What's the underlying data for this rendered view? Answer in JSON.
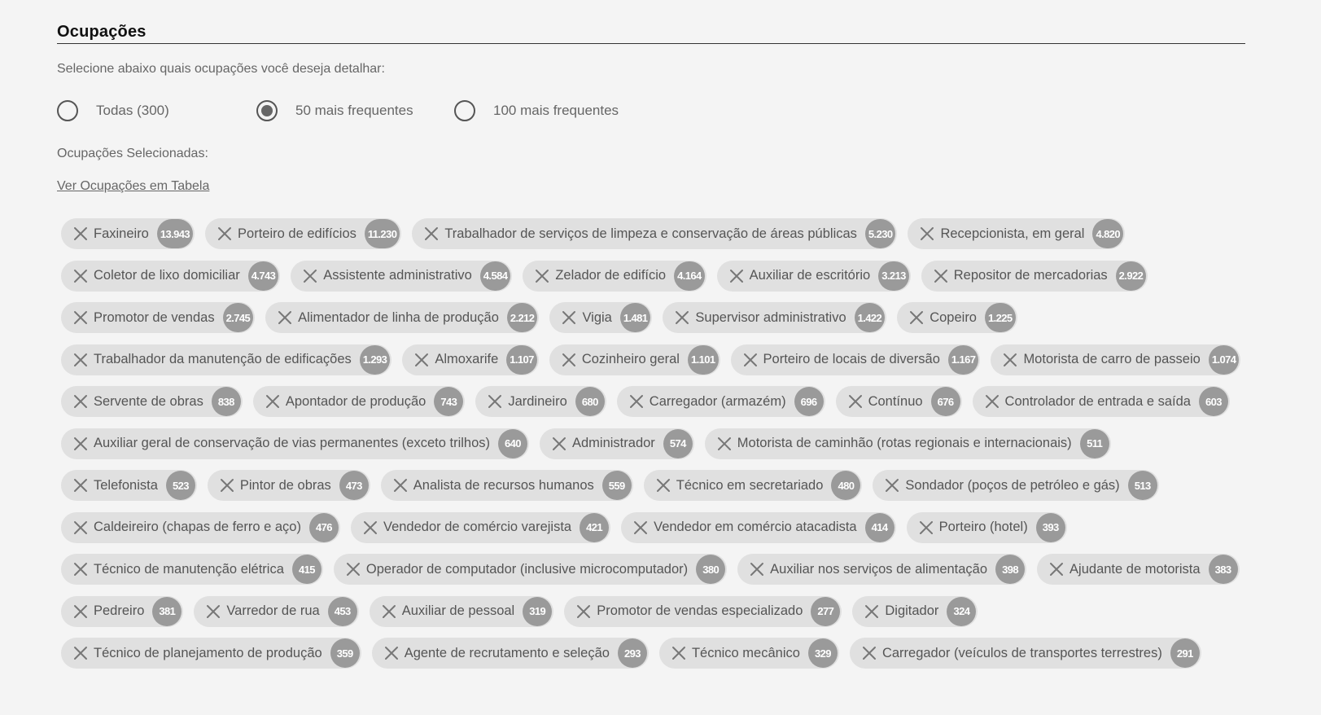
{
  "section": {
    "title": "Ocupações",
    "prompt": "Selecione abaixo quais ocupações você deseja detalhar:",
    "selected_label": "Ocupações Selecionadas:",
    "table_link": "Ver Ocupações em Tabela"
  },
  "radio_options": [
    {
      "label": "Todas (300)",
      "checked": false
    },
    {
      "label": "50 mais frequentes",
      "checked": true
    },
    {
      "label": "100 mais frequentes",
      "checked": false
    }
  ],
  "occupations": [
    {
      "label": "Faxineiro",
      "count": "13.943"
    },
    {
      "label": "Porteiro de edifícios",
      "count": "11.230"
    },
    {
      "label": "Trabalhador de serviços de limpeza e conservação de áreas públicas",
      "count": "5.230"
    },
    {
      "label": "Recepcionista, em geral",
      "count": "4.820"
    },
    {
      "label": "Coletor de lixo domiciliar",
      "count": "4.743"
    },
    {
      "label": "Assistente administrativo",
      "count": "4.584"
    },
    {
      "label": "Zelador de edifício",
      "count": "4.164"
    },
    {
      "label": "Auxiliar de escritório",
      "count": "3.213"
    },
    {
      "label": "Repositor de mercadorias",
      "count": "2.922"
    },
    {
      "label": "Promotor de vendas",
      "count": "2.745"
    },
    {
      "label": "Alimentador de linha de produção",
      "count": "2.212"
    },
    {
      "label": "Vigia",
      "count": "1.481"
    },
    {
      "label": "Supervisor administrativo",
      "count": "1.422"
    },
    {
      "label": "Copeiro",
      "count": "1.225"
    },
    {
      "label": "Trabalhador da manutenção de edificações",
      "count": "1.293"
    },
    {
      "label": "Almoxarife",
      "count": "1.107"
    },
    {
      "label": "Cozinheiro geral",
      "count": "1.101"
    },
    {
      "label": "Porteiro de locais de diversão",
      "count": "1.167"
    },
    {
      "label": "Motorista de carro de passeio",
      "count": "1.074"
    },
    {
      "label": "Servente de obras",
      "count": "838"
    },
    {
      "label": "Apontador de produção",
      "count": "743"
    },
    {
      "label": "Jardineiro",
      "count": "680"
    },
    {
      "label": "Carregador (armazém)",
      "count": "696"
    },
    {
      "label": "Contínuo",
      "count": "676"
    },
    {
      "label": "Controlador de entrada e saída",
      "count": "603"
    },
    {
      "label": "Auxiliar geral de conservação de vias permanentes (exceto trilhos)",
      "count": "640"
    },
    {
      "label": "Administrador",
      "count": "574"
    },
    {
      "label": "Motorista de caminhão (rotas regionais e internacionais)",
      "count": "511"
    },
    {
      "label": "Telefonista",
      "count": "523"
    },
    {
      "label": "Pintor de obras",
      "count": "473"
    },
    {
      "label": "Analista de recursos humanos",
      "count": "559"
    },
    {
      "label": "Técnico em secretariado",
      "count": "480"
    },
    {
      "label": "Sondador (poços de petróleo e gás)",
      "count": "513"
    },
    {
      "label": "Caldeireiro (chapas de ferro e aço)",
      "count": "476"
    },
    {
      "label": "Vendedor de comércio varejista",
      "count": "421"
    },
    {
      "label": "Vendedor em comércio atacadista",
      "count": "414"
    },
    {
      "label": "Porteiro (hotel)",
      "count": "393"
    },
    {
      "label": "Técnico de manutenção elétrica",
      "count": "415"
    },
    {
      "label": "Operador de computador (inclusive microcomputador)",
      "count": "380"
    },
    {
      "label": "Auxiliar nos serviços de alimentação",
      "count": "398"
    },
    {
      "label": "Ajudante de motorista",
      "count": "383"
    },
    {
      "label": "Pedreiro",
      "count": "381"
    },
    {
      "label": "Varredor de rua",
      "count": "453"
    },
    {
      "label": "Auxiliar de pessoal",
      "count": "319"
    },
    {
      "label": "Promotor de vendas especializado",
      "count": "277"
    },
    {
      "label": "Digitador",
      "count": "324"
    },
    {
      "label": "Técnico de planejamento de produção",
      "count": "359"
    },
    {
      "label": "Agente de recrutamento e seleção",
      "count": "293"
    },
    {
      "label": "Técnico mecânico",
      "count": "329"
    },
    {
      "label": "Carregador (veículos de transportes terrestres)",
      "count": "291"
    }
  ]
}
